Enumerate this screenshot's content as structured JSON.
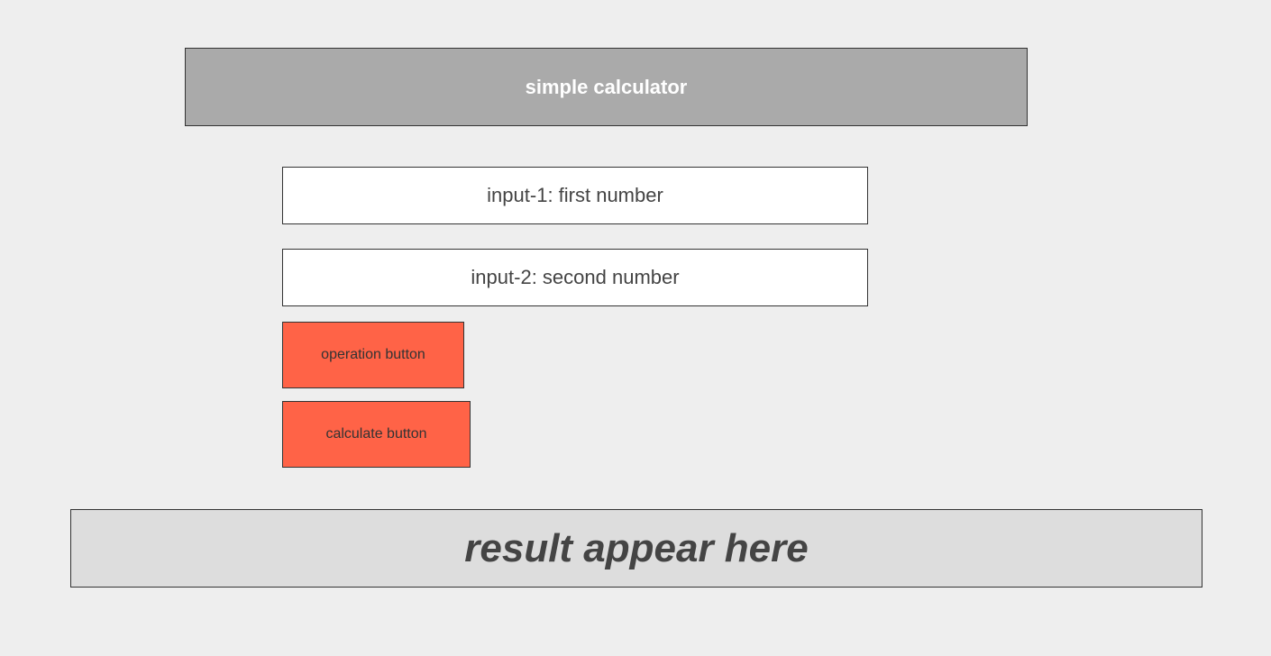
{
  "header": {
    "title": "simple calculator"
  },
  "inputs": {
    "first": {
      "value": "",
      "placeholder": "input-1: first number"
    },
    "second": {
      "value": "",
      "placeholder": "input-2: second number"
    }
  },
  "buttons": {
    "operation_label": "operation button",
    "calculate_label": "calculate button"
  },
  "result": {
    "text": "result appear here"
  },
  "colors": {
    "background": "#eeeeee",
    "header": "#aaaaaa",
    "button": "#ff6347",
    "result_panel": "#dddddd"
  }
}
